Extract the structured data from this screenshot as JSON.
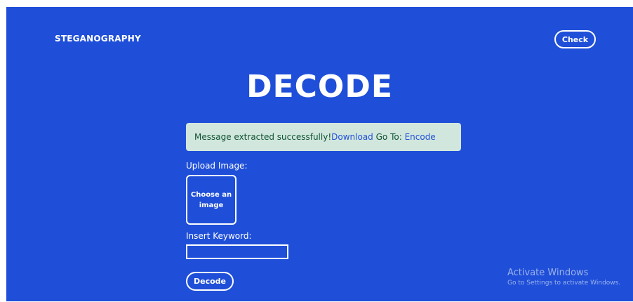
{
  "header": {
    "brand": "STEGANOGRAPHY",
    "check_label": "Check"
  },
  "main": {
    "title": "DECODE",
    "alert": {
      "message": "Message extracted successfully! ",
      "download_link": "Download",
      "goto_text": " Go To: ",
      "encode_link": "Encode"
    },
    "upload_label": "Upload Image:",
    "upload_button": "Choose an image",
    "keyword_label": "Insert Keyword:",
    "keyword_value": "",
    "decode_label": "Decode"
  },
  "watermark": {
    "title": "Activate Windows",
    "subtitle": "Go to Settings to activate Windows."
  },
  "colors": {
    "background": "#1f4fd8",
    "alert_bg": "#d1e7dd",
    "alert_text": "#0f5132",
    "link": "#1f4fd8"
  }
}
